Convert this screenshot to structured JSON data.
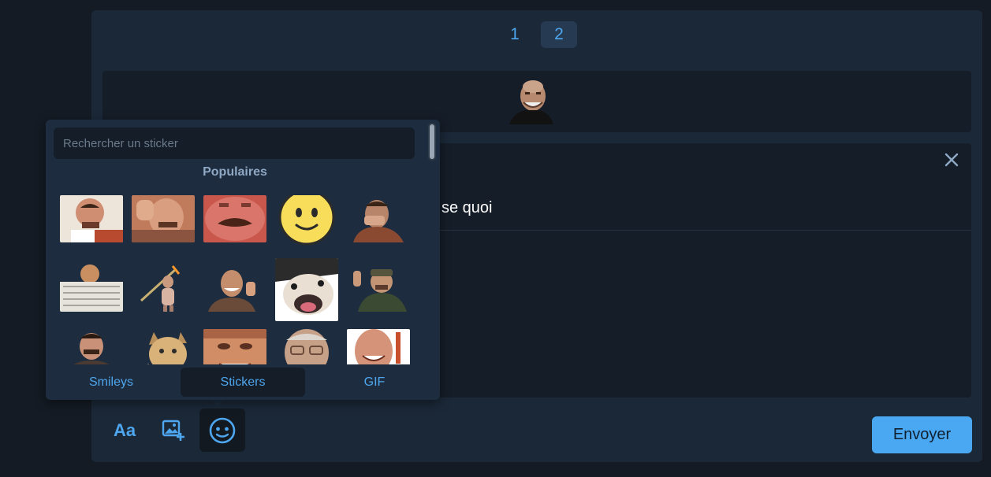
{
  "pagination": {
    "pages": [
      "1",
      "2"
    ],
    "current": "2"
  },
  "preview": {
    "sticker": "bald-man-smiling-sticker"
  },
  "editor": {
    "text_fragment": "se quoi",
    "close_icon": "close-icon"
  },
  "toolbar": {
    "text_format_label": "Aa",
    "image_icon": "add-image-icon",
    "sticker_icon": "smiley-sticker-icon",
    "send_label": "Envoyer"
  },
  "sticker_picker": {
    "search_placeholder": "Rechercher un sticker",
    "section_title": "Populaires",
    "stickers": [
      "man-drinking-tea",
      "man-laughing-hand-forehead",
      "mustache-closeup",
      "yellow-smiley-face",
      "man-laughing-covering-face",
      "man-reading-newspaper",
      "figure-with-spear",
      "man-thumbs-up",
      "smiling-dog",
      "man-waving-cap",
      "man-mustache",
      "cat",
      "face-closeup",
      "old-man-glasses",
      "man-laughing"
    ],
    "tabs": [
      {
        "label": "Smileys"
      },
      {
        "label": "Stickers"
      },
      {
        "label": "GIF"
      }
    ],
    "active_tab": "Stickers"
  },
  "colors": {
    "accent": "#4ea6ee",
    "panel": "#1b2838",
    "background": "#141b24",
    "send": "#4aa8f2"
  }
}
